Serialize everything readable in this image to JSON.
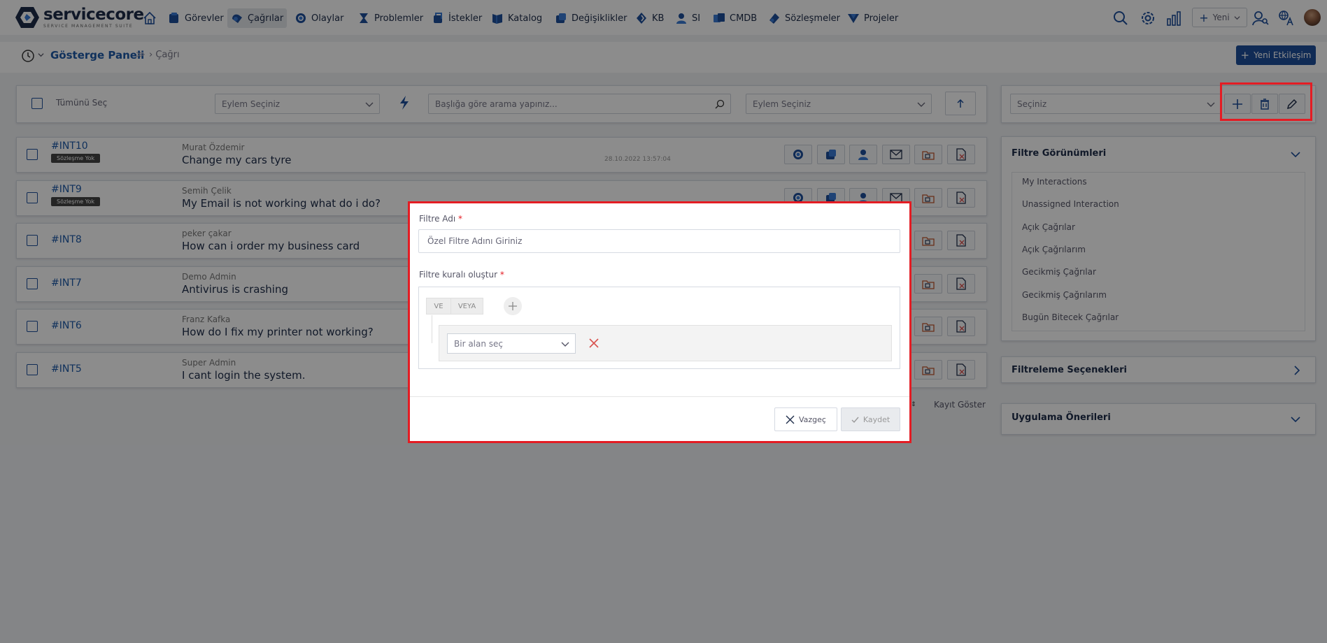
{
  "brand": {
    "name": "servicecore",
    "tagline": "SERVICE MANAGEMENT SUITE"
  },
  "nav": {
    "items": [
      {
        "id": "home",
        "label": ""
      },
      {
        "id": "gorevler",
        "label": "Görevler"
      },
      {
        "id": "cagrilar",
        "label": "Çağrılar",
        "active": true
      },
      {
        "id": "olaylar",
        "label": "Olaylar"
      },
      {
        "id": "problemler",
        "label": "Problemler"
      },
      {
        "id": "istekler",
        "label": "İstekler"
      },
      {
        "id": "katalog",
        "label": "Katalog"
      },
      {
        "id": "degisiklikler",
        "label": "Değişiklikler"
      },
      {
        "id": "kb",
        "label": "KB"
      },
      {
        "id": "si",
        "label": "SI"
      },
      {
        "id": "cmdb",
        "label": "CMDB"
      },
      {
        "id": "sozlesmeler",
        "label": "Sözleşmeler"
      },
      {
        "id": "projeler",
        "label": "Projeler"
      }
    ],
    "new_label": "Yeni"
  },
  "breadcrumb": {
    "link": "Gösterge Paneli",
    "current": "Çağrı"
  },
  "new_interaction_label": "Yeni Etkileşim",
  "toolbar": {
    "select_all": "Tümünü Seç",
    "action_select": "Eylem Seçiniz",
    "search_placeholder": "Başlığa göre arama yapınız...",
    "action_select_2": "Eylem Seçiniz"
  },
  "rows": [
    {
      "id": "#INT10",
      "badge": "Sözleşme Yok",
      "person": "Murat Özdemir",
      "title": "Change my cars tyre",
      "date": "28.10.2022 13:57:04"
    },
    {
      "id": "#INT9",
      "badge": "Sözleşme Yok",
      "person": "Semih Çelik",
      "title": "My Email is not working what do i do?",
      "date": ""
    },
    {
      "id": "#INT8",
      "badge": "",
      "person": "peker çakar",
      "title": "How can i order my business card",
      "date": ""
    },
    {
      "id": "#INT7",
      "badge": "",
      "person": "Demo Admin",
      "title": "Antivirus is crashing",
      "date": ""
    },
    {
      "id": "#INT6",
      "badge": "",
      "person": "Franz Kafka",
      "title": "How do I fix my printer not working?",
      "date": ""
    },
    {
      "id": "#INT5",
      "badge": "",
      "person": "Super Admin",
      "title": "I cant login the system.",
      "date": ""
    }
  ],
  "pagination": {
    "show_records": "Kayıt Göster"
  },
  "right": {
    "filter_select": "Seçiniz",
    "filter_views_title": "Filtre Görünümleri",
    "filter_views": [
      "My Interactions",
      "Unassigned Interaction",
      "Açık Çağrılar",
      "Açık Çağrılarım",
      "Gecikmiş Çağrılar",
      "Gecikmiş Çağrılarım",
      "Bugün Bitecek Çağrılar"
    ],
    "filter_options_title": "Filtreleme Seçenekleri",
    "app_suggestions_title": "Uygulama Önerileri"
  },
  "modal": {
    "name_label": "Filtre Adı",
    "name_placeholder": "Özel Filtre Adını Giriniz",
    "rule_label": "Filtre kuralı oluştur",
    "and_label": "VE",
    "or_label": "VEYA",
    "field_placeholder": "Bir alan seç",
    "cancel_label": "Vazgeç",
    "save_label": "Kaydet",
    "required_mark": "*"
  },
  "colors": {
    "primary": "#1e4f9c",
    "link": "#1e5aa8",
    "highlight": "#e41c23",
    "navy": "#1e2d4a"
  }
}
